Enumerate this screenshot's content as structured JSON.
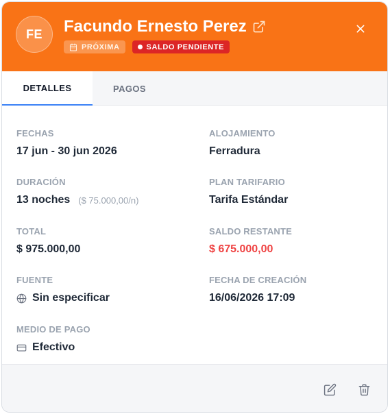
{
  "header": {
    "initials": "FE",
    "guest_name": "Facundo Ernesto Perez",
    "badges": {
      "proxima": "PRÓXIMA",
      "saldo": "SALDO PENDIENTE"
    }
  },
  "tabs": [
    {
      "label": "DETALLES",
      "active": true
    },
    {
      "label": "PAGOS",
      "active": false
    }
  ],
  "details": {
    "fechas": {
      "label": "FECHAS",
      "value": "17 jun - 30 jun 2026"
    },
    "alojamiento": {
      "label": "ALOJAMIENTO",
      "value": "Ferradura"
    },
    "duracion": {
      "label": "DURACIÓN",
      "value": "13 noches",
      "rate": "($ 75.000,00/n)"
    },
    "plan": {
      "label": "PLAN TARIFARIO",
      "value": "Tarifa Estándar"
    },
    "total": {
      "label": "TOTAL",
      "value": "$ 975.000,00"
    },
    "saldo": {
      "label": "SALDO RESTANTE",
      "value": "$ 675.000,00"
    },
    "fuente": {
      "label": "FUENTE",
      "value": "Sin especificar"
    },
    "creacion": {
      "label": "FECHA DE CREACIÓN",
      "value": "16/06/2026 17:09"
    },
    "medio": {
      "label": "MEDIO DE PAGO",
      "value": "Efectivo"
    }
  },
  "colors": {
    "header": "#f97316",
    "danger": "#ef4444",
    "tab_accent": "#3b82f6"
  },
  "icons": [
    "external-link-icon",
    "calendar-icon",
    "close-icon",
    "globe-icon",
    "credit-card-icon",
    "edit-icon",
    "trash-icon"
  ]
}
